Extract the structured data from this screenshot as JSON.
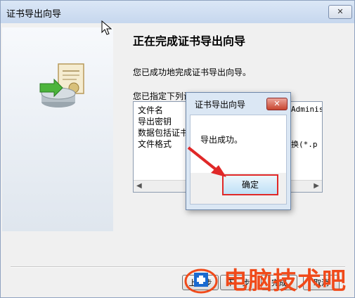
{
  "window": {
    "title": "证书导出向导",
    "close_symbol": "✕"
  },
  "page": {
    "heading": "正在完成证书导出向导",
    "success_text": "您已成功地完成证书导出向导。",
    "specified_label": "您已指定下列设置",
    "settings_rows": [
      "文件名",
      "导出密钥",
      "数据包括证书",
      "文件格式"
    ],
    "settings_values": [
      "Adminis",
      "换(*.p"
    ]
  },
  "buttons": {
    "back": "上一步",
    "next": "下一步",
    "finish": "完成",
    "cancel": "取消"
  },
  "dialog": {
    "title": "证书导出向导",
    "close_symbol": "✕",
    "message": "导出成功。",
    "ok": "确定"
  },
  "watermark": {
    "text": "电脑技术吧"
  },
  "colors": {
    "highlight": "#e02828",
    "watermark": "#f04a1a"
  }
}
